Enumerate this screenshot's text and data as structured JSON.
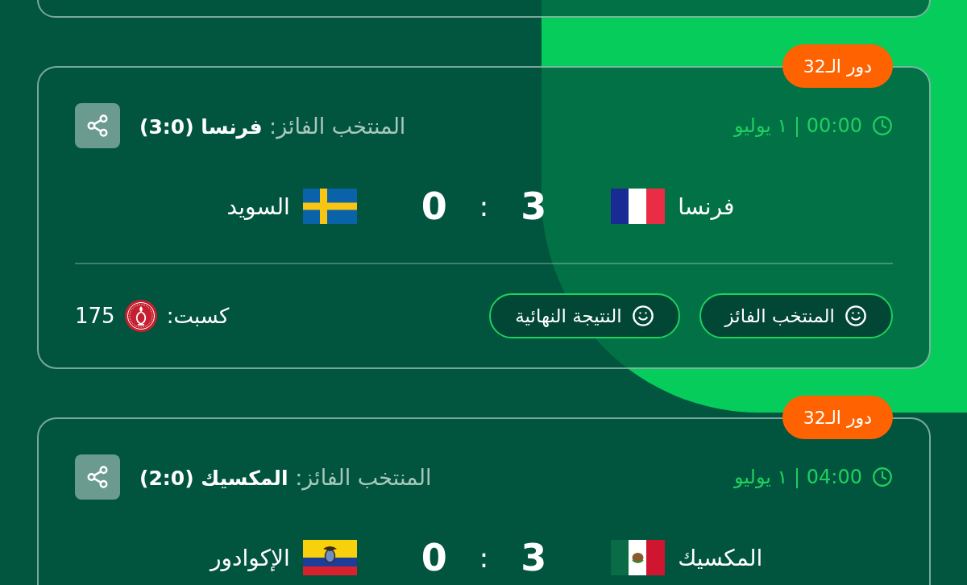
{
  "matches": [
    {
      "round": "دور الـ32",
      "time": "00:00 | ١ يوليو",
      "winner": "المنتخب الفائز: **فرنسا (3:0)**",
      "home": {
        "name": "فرنسا",
        "kind": "france",
        "score": "3"
      },
      "separator": ":",
      "away": {
        "name": "السويد",
        "kind": "sweden",
        "score": "0"
      },
      "picks": [
        "المنتخب الفائز",
        "النتيجة النهائية"
      ],
      "earned": {
        "label": "كسبت:",
        "points": "175"
      }
    },
    {
      "round": "دور الـ32",
      "time": "04:00 | ١ يوليو",
      "winner": "المنتخب الفائز: **المكسيك (2:0)**",
      "home": {
        "name": "المكسيك",
        "kind": "mexico",
        "score": "3"
      },
      "separator": ":",
      "away": {
        "name": "الإكوادور",
        "kind": "ecuador",
        "score": "0"
      }
    }
  ]
}
